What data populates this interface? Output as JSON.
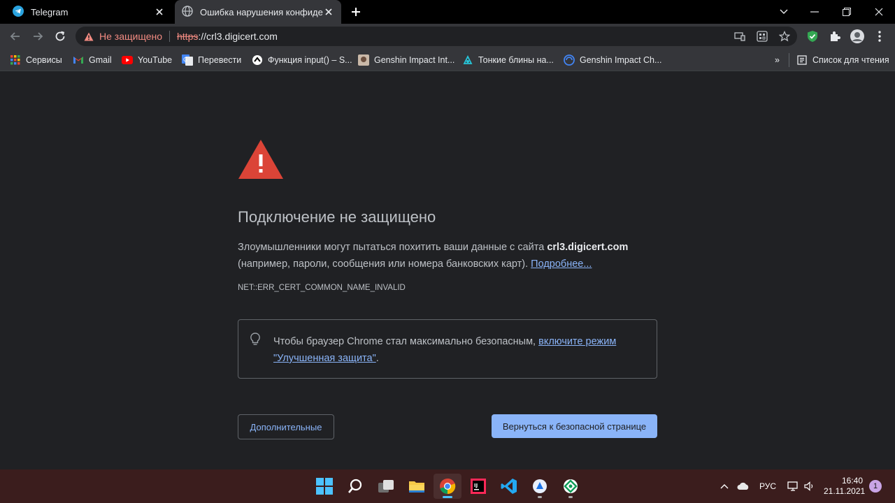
{
  "tabs": [
    {
      "title": "Telegram",
      "icon": "telegram-icon"
    },
    {
      "title": "Ошибка нарушения конфиденц",
      "icon": "globe-icon",
      "active": true
    }
  ],
  "omnibox": {
    "security_label": "Не защищено",
    "scheme": "https",
    "rest": "://crl3.digicert.com"
  },
  "bookmarks": [
    {
      "label": "Сервисы",
      "icon": "apps-grid-icon"
    },
    {
      "label": "Gmail",
      "icon": "gmail-icon"
    },
    {
      "label": "YouTube",
      "icon": "youtube-icon"
    },
    {
      "label": "Перевести",
      "icon": "translate-icon"
    },
    {
      "label": "Функция input() – S...",
      "icon": "site-icon"
    },
    {
      "label": "Genshin Impact Int...",
      "icon": "site-icon"
    },
    {
      "label": "Тонкие блины на...",
      "icon": "site-icon"
    },
    {
      "label": "Genshin Impact Ch...",
      "icon": "site-icon"
    }
  ],
  "reading_list": "Список для чтения",
  "overflow": "»",
  "page": {
    "heading": "Подключение не защищено",
    "desc_part1": "Злоумышленники могут пытаться похитить ваши данные с сайта ",
    "desc_host": "crl3.digicert.com",
    "desc_part2": " (например, пароли, сообщения или номера банковских карт). ",
    "desc_link": "Подробнее...",
    "error_code": "NET::ERR_CERT_COMMON_NAME_INVALID",
    "tip_part1": "Чтобы браузер Chrome стал максимально безопасным, ",
    "tip_link": "включите режим \"Улучшенная защита\"",
    "tip_end": ".",
    "advanced_button": "Дополнительные",
    "back_button": "Вернуться к безопасной странице"
  },
  "taskbar": {
    "lang": "РУС",
    "time": "16:40",
    "date": "21.11.2021",
    "notifications": "1"
  },
  "colors": {
    "accent": "#8ab4f8",
    "danger": "#f28b82",
    "warning_red": "#db4437",
    "page_bg": "#202124",
    "taskbar_bg": "#3b1d1d"
  }
}
